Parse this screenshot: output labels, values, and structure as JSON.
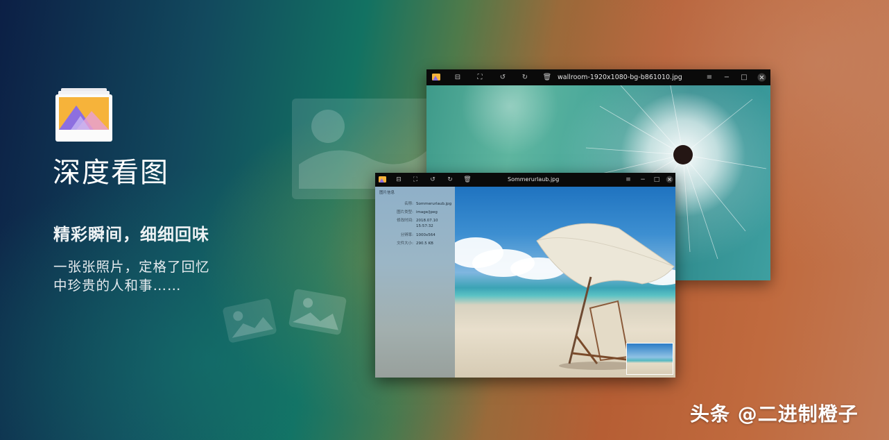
{
  "app": {
    "icon": "image-viewer-icon",
    "title": "深度看图",
    "subtitle": "精彩瞬间，细细回味",
    "description_lines": [
      "一张张照片，定格了回忆",
      "中珍贵的人和事……"
    ]
  },
  "back_window": {
    "filename": "wallroom-1920x1080-bg-b861010.jpg",
    "toolbar_icons": [
      "app-icon",
      "thumbnail-icon",
      "fit-screen-icon",
      "rotate-left-icon",
      "rotate-right-icon",
      "trash-icon"
    ],
    "window_icons": [
      "menu-icon",
      "minimize-icon",
      "maximize-icon",
      "close-icon"
    ]
  },
  "front_window": {
    "filename": "Sommerurlaub.jpg",
    "info_panel": {
      "heading": "图片信息",
      "rows": [
        {
          "key": "名称:",
          "value": "Sommerurlaub.jpg"
        },
        {
          "key": "图片类型:",
          "value": "image/jpeg"
        },
        {
          "key": "修改时间:",
          "value": "2018.07.10"
        },
        {
          "key": "",
          "value": "15:57:32"
        },
        {
          "key": "分辨率:",
          "value": "1000x564"
        },
        {
          "key": "文件大小:",
          "value": "290.5  KB"
        }
      ]
    }
  },
  "watermark": "头条 @二进制橙子",
  "colors": {
    "logo_orange": "#f6b33a",
    "logo_purple": "#8d6fe0",
    "titlebar": "#0a0a0a"
  }
}
